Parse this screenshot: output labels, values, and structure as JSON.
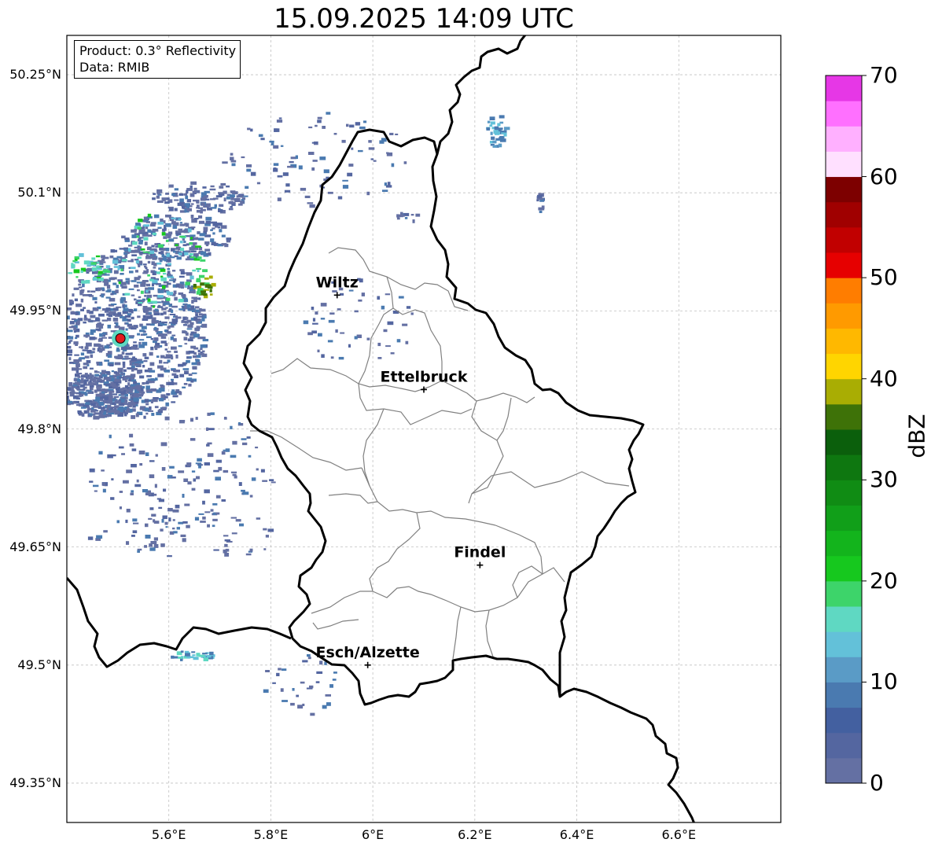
{
  "title": "15.09.2025 14:09 UTC",
  "infobox": {
    "product": "Product: 0.3° Reflectivity",
    "data": "Data: RMIB"
  },
  "map": {
    "lon_range": [
      5.4,
      6.8
    ],
    "lat_range": [
      49.3,
      50.3
    ],
    "lat_ticks": [
      {
        "value": 50.25,
        "label": "50.25°N"
      },
      {
        "value": 50.1,
        "label": "50.1°N"
      },
      {
        "value": 49.95,
        "label": "49.95°N"
      },
      {
        "value": 49.8,
        "label": "49.8°N"
      },
      {
        "value": 49.65,
        "label": "49.65°N"
      },
      {
        "value": 49.5,
        "label": "49.5°N"
      },
      {
        "value": 49.35,
        "label": "49.35°N"
      }
    ],
    "lon_ticks": [
      {
        "value": 5.6,
        "label": "5.6°E"
      },
      {
        "value": 5.8,
        "label": "5.8°E"
      },
      {
        "value": 6.0,
        "label": "6°E"
      },
      {
        "value": 6.2,
        "label": "6.2°E"
      },
      {
        "value": 6.4,
        "label": "6.4°E"
      },
      {
        "value": 6.6,
        "label": "6.6°E"
      }
    ],
    "grid": true,
    "cities": [
      {
        "name": "Wiltz",
        "lon": 5.93,
        "lat": 49.97
      },
      {
        "name": "Ettelbruck",
        "lon": 6.1,
        "lat": 49.85
      },
      {
        "name": "Findel",
        "lon": 6.21,
        "lat": 49.627
      },
      {
        "name": "Esch/Alzette",
        "lon": 5.99,
        "lat": 49.5
      }
    ],
    "radar_site": {
      "lon": 5.505,
      "lat": 49.915,
      "color": "#e31a1c"
    }
  },
  "colorbar": {
    "label": "dBZ",
    "ticks": [
      "0",
      "10",
      "20",
      "30",
      "40",
      "50",
      "60",
      "70"
    ],
    "colors": [
      "#6470a3",
      "#5466a0",
      "#4360a0",
      "#4a7ab0",
      "#5a9bc6",
      "#63c1d9",
      "#5fd8c2",
      "#3dd46a",
      "#16c81e",
      "#13b41c",
      "#119f19",
      "#108c14",
      "#0e7710",
      "#0b5f0c",
      "#3e7208",
      "#a9ad03",
      "#ffd500",
      "#ffb800",
      "#ff9a00",
      "#ff7d00",
      "#e60000",
      "#c10000",
      "#a00000",
      "#7d0000",
      "#ffe0ff",
      "#ffb0ff",
      "#ff70ff",
      "#e637e6"
    ]
  }
}
